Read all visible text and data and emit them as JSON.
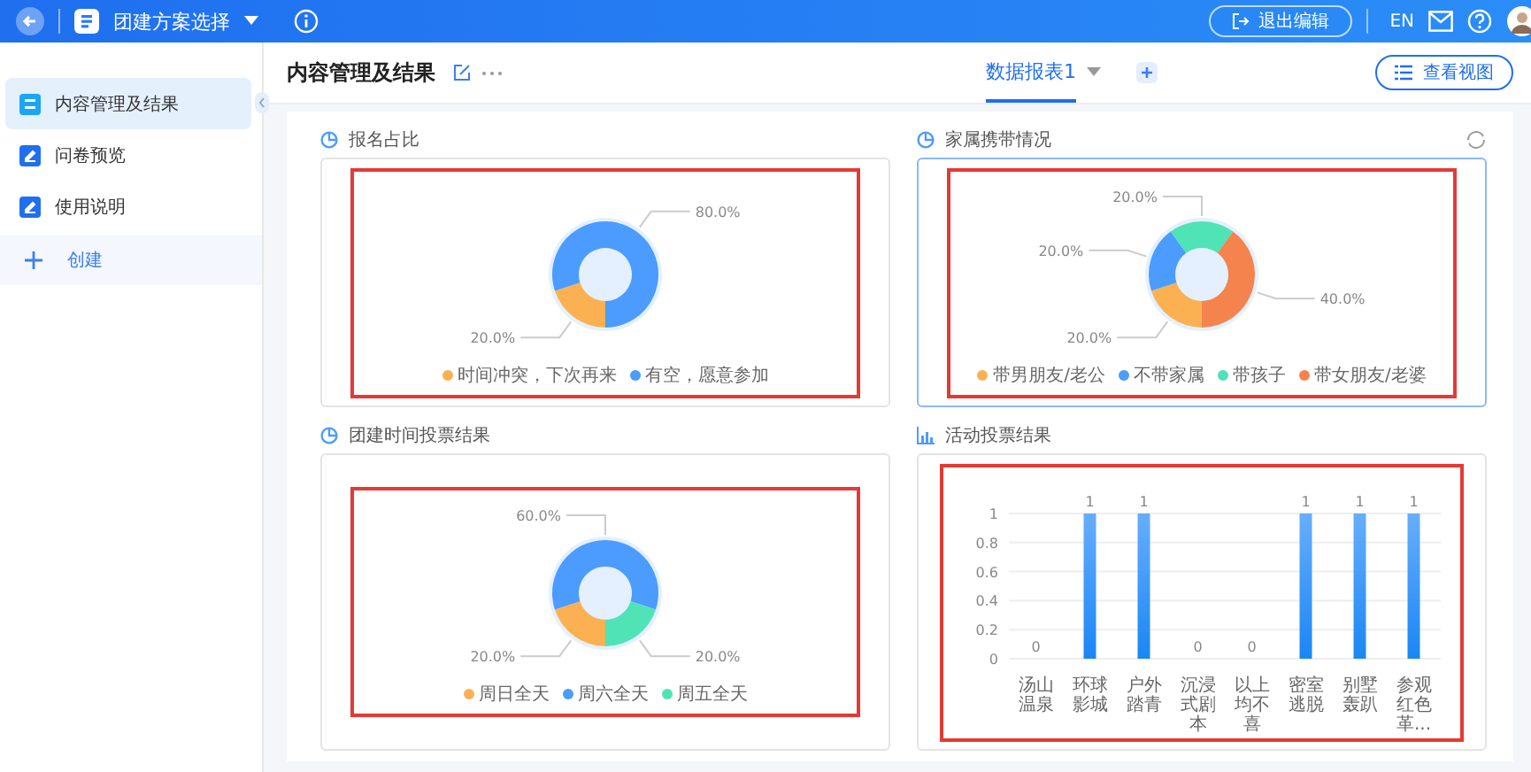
{
  "top_bar": {
    "title": "团建方案选择",
    "exit_button": "退出编辑",
    "language": "EN"
  },
  "header": {
    "title": "内容管理及结果",
    "tabs": [
      {
        "label": "数据报表1",
        "selected": true
      }
    ],
    "view_button": "查看视图"
  },
  "sidebar": {
    "items": [
      {
        "label": "内容管理及结果",
        "selected": true
      },
      {
        "label": "问卷预览",
        "selected": false
      },
      {
        "label": "使用说明",
        "selected": false
      }
    ],
    "create_button": "创建"
  },
  "panels": [
    {
      "title": "报名占比",
      "kind": "pie",
      "selected": false,
      "chart_data": {
        "type": "donut",
        "categories": [
          "时间冲突，下次再来",
          "有空，愿意参加"
        ],
        "values": [
          20,
          80
        ],
        "value_labels": [
          "20.0%",
          "80.0%"
        ],
        "legend": "bottom"
      }
    },
    {
      "title": "家属携带情况",
      "kind": "pie",
      "selected": true,
      "chart_data": {
        "type": "donut",
        "categories": [
          "带男朋友/老公",
          "不带家属",
          "带孩子",
          "带女朋友/老婆"
        ],
        "values": [
          20,
          20,
          20,
          40
        ],
        "value_labels": [
          "20.0%",
          "20.0%",
          "20.0%",
          "40.0%"
        ],
        "legend": "bottom"
      }
    },
    {
      "title": "团建时间投票结果",
      "kind": "pie",
      "selected": false,
      "chart_data": {
        "type": "donut",
        "categories": [
          "周日全天",
          "周六全天",
          "周五全天"
        ],
        "values": [
          20,
          60,
          20
        ],
        "value_labels": [
          "20.0%",
          "60.0%",
          "20.0%"
        ],
        "legend": "bottom"
      }
    },
    {
      "title": "活动投票结果",
      "kind": "bar",
      "selected": false,
      "chart_data": {
        "type": "bar",
        "categories": [
          "汤山温泉",
          "环球影城",
          "户外踏青",
          "沉浸式剧本",
          "以上均不喜",
          "密室逃脱",
          "别墅轰趴",
          "参观红色革..."
        ],
        "values": [
          0,
          1,
          1,
          0,
          0,
          1,
          1,
          1
        ],
        "ylim": [
          0,
          1
        ],
        "yticks": [
          0,
          0.2,
          0.4,
          0.6,
          0.8,
          1
        ],
        "grid": true,
        "data_labels": true
      }
    }
  ]
}
